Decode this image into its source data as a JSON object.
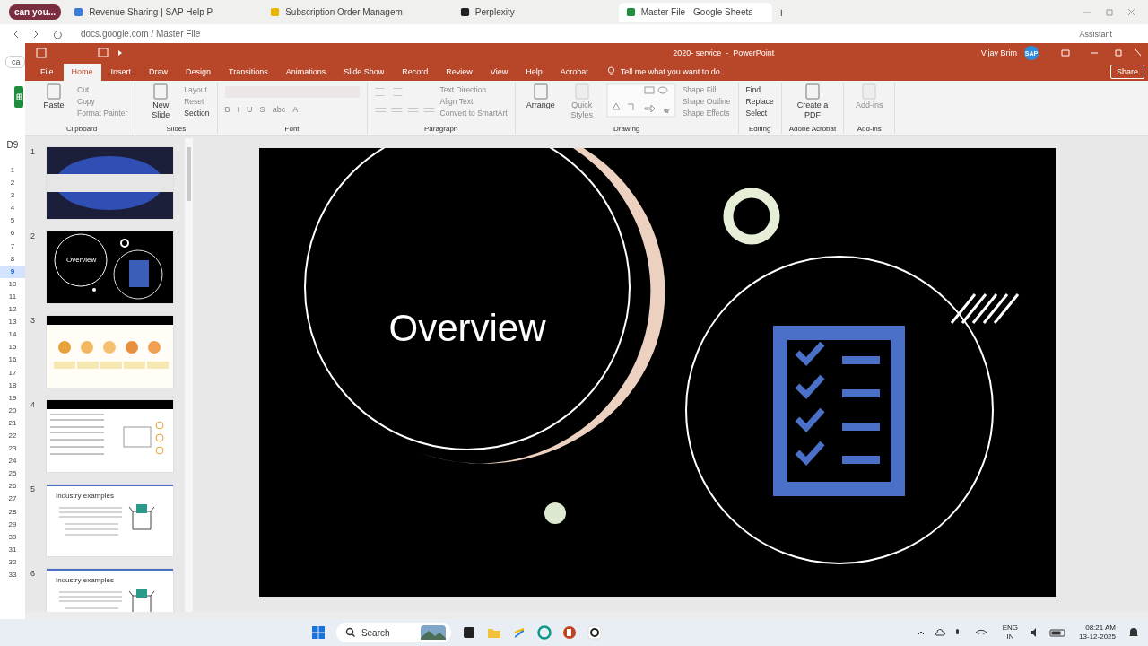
{
  "browser": {
    "tab_group": "can you...",
    "tabs": [
      {
        "title": "Revenue Sharing | SAP Help P",
        "selected": false
      },
      {
        "title": "Subscription Order Managem",
        "selected": false
      },
      {
        "title": "Perplexity",
        "selected": false
      },
      {
        "title": "Master File - Google Sheets",
        "selected": true
      }
    ],
    "new_tab": "+",
    "address": "docs.google.com / Master File",
    "assistant": "Assistant"
  },
  "sheet": {
    "chip": "ca",
    "cell_ref": "D9",
    "rows": [
      {
        "label": "1",
        "selected": false
      },
      {
        "label": "2",
        "selected": false
      },
      {
        "label": "3",
        "selected": false
      },
      {
        "label": "4",
        "selected": false
      },
      {
        "label": "5",
        "selected": false
      },
      {
        "label": "6",
        "selected": false
      },
      {
        "label": "7",
        "selected": false
      },
      {
        "label": "8",
        "selected": false
      },
      {
        "label": "9",
        "selected": true
      },
      {
        "label": "10",
        "selected": false
      },
      {
        "label": "11",
        "selected": false
      },
      {
        "label": "12",
        "selected": false
      },
      {
        "label": "13",
        "selected": false
      },
      {
        "label": "14",
        "selected": false
      },
      {
        "label": "15",
        "selected": false
      },
      {
        "label": "16",
        "selected": false
      },
      {
        "label": "17",
        "selected": false
      },
      {
        "label": "18",
        "selected": false
      },
      {
        "label": "19",
        "selected": false
      },
      {
        "label": "20",
        "selected": false
      },
      {
        "label": "21",
        "selected": false
      },
      {
        "label": "22",
        "selected": false
      },
      {
        "label": "23",
        "selected": false
      },
      {
        "label": "24",
        "selected": false
      },
      {
        "label": "25",
        "selected": false
      },
      {
        "label": "26",
        "selected": false
      },
      {
        "label": "27",
        "selected": false
      },
      {
        "label": "28",
        "selected": false
      },
      {
        "label": "29",
        "selected": false
      },
      {
        "label": "30",
        "selected": false
      },
      {
        "label": "31",
        "selected": false
      },
      {
        "label": "32",
        "selected": false
      },
      {
        "label": "33",
        "selected": false
      }
    ]
  },
  "powerpoint": {
    "title": "2020- service  -  PowerPoint",
    "user": "Vijay Brim",
    "avatar": "SAP",
    "share": "Share",
    "tell_me": "Tell me what you want to do",
    "menu": [
      {
        "label": "File",
        "selected": false
      },
      {
        "label": "Home",
        "selected": true
      },
      {
        "label": "Insert",
        "selected": false
      },
      {
        "label": "Draw",
        "selected": false
      },
      {
        "label": "Design",
        "selected": false
      },
      {
        "label": "Transitions",
        "selected": false
      },
      {
        "label": "Animations",
        "selected": false
      },
      {
        "label": "Slide Show",
        "selected": false
      },
      {
        "label": "Record",
        "selected": false
      },
      {
        "label": "Review",
        "selected": false
      },
      {
        "label": "View",
        "selected": false
      },
      {
        "label": "Help",
        "selected": false
      },
      {
        "label": "Acrobat",
        "selected": false
      }
    ],
    "groups": [
      {
        "name": "Clipboard",
        "items": [
          {
            "label": "Paste",
            "kind": "large",
            "disabled": false
          },
          {
            "label": "Cut",
            "kind": "small",
            "disabled": true
          },
          {
            "label": "Copy",
            "kind": "small",
            "disabled": true
          },
          {
            "label": "Format Painter",
            "kind": "small",
            "disabled": true
          }
        ]
      },
      {
        "name": "Slides",
        "items": [
          {
            "label": "New Slide",
            "kind": "large",
            "disabled": false
          },
          {
            "label": "Layout",
            "kind": "small",
            "disabled": true
          },
          {
            "label": "Reset",
            "kind": "small",
            "disabled": true
          },
          {
            "label": "Section",
            "kind": "small",
            "disabled": false
          }
        ]
      },
      {
        "name": "Font",
        "items": [
          {
            "label": "B",
            "kind": "glyph",
            "disabled": true
          },
          {
            "label": "I",
            "kind": "glyph",
            "disabled": true
          },
          {
            "label": "U",
            "kind": "glyph",
            "disabled": true
          },
          {
            "label": "S",
            "kind": "glyph",
            "disabled": true
          },
          {
            "label": "abc",
            "kind": "glyph",
            "disabled": true
          },
          {
            "label": "A",
            "kind": "glyph",
            "disabled": true
          }
        ]
      },
      {
        "name": "Paragraph",
        "items": [
          {
            "label": "Text Direction",
            "kind": "small",
            "disabled": true
          },
          {
            "label": "Align Text",
            "kind": "small",
            "disabled": true
          },
          {
            "label": "Convert to SmartArt",
            "kind": "small",
            "disabled": true
          }
        ]
      },
      {
        "name": "Drawing",
        "items": [
          {
            "label": "Arrange",
            "kind": "large",
            "disabled": false
          },
          {
            "label": "Quick Styles",
            "kind": "large",
            "disabled": true
          },
          {
            "label": "Shape Fill",
            "kind": "small",
            "disabled": true
          },
          {
            "label": "Shape Outline",
            "kind": "small",
            "disabled": true
          },
          {
            "label": "Shape Effects",
            "kind": "small",
            "disabled": true
          }
        ]
      },
      {
        "name": "Editing",
        "items": [
          {
            "label": "Find",
            "kind": "small",
            "disabled": false
          },
          {
            "label": "Replace",
            "kind": "small",
            "disabled": false
          },
          {
            "label": "Select",
            "kind": "small",
            "disabled": false
          }
        ]
      },
      {
        "name": "Adobe Acrobat",
        "items": [
          {
            "label": "Create a PDF",
            "kind": "large",
            "disabled": false
          }
        ]
      },
      {
        "name": "Add-ins",
        "items": [
          {
            "label": "Add-ins",
            "kind": "large",
            "disabled": true
          }
        ]
      }
    ],
    "thumbnails": [
      {
        "number": "1",
        "kind": "blue"
      },
      {
        "number": "2",
        "kind": "overview",
        "text": "Overview"
      },
      {
        "number": "3",
        "kind": "icons"
      },
      {
        "number": "4",
        "kind": "capabilities"
      },
      {
        "number": "5",
        "kind": "industry",
        "text": "Industry examples"
      },
      {
        "number": "6",
        "kind": "industry",
        "text": "Industry examples"
      }
    ],
    "slide": {
      "title": "Overview"
    }
  },
  "taskbar": {
    "search": "Search",
    "language": "ENG",
    "region": "IN",
    "time": "08:21 AM",
    "date": "13-12-2025"
  }
}
